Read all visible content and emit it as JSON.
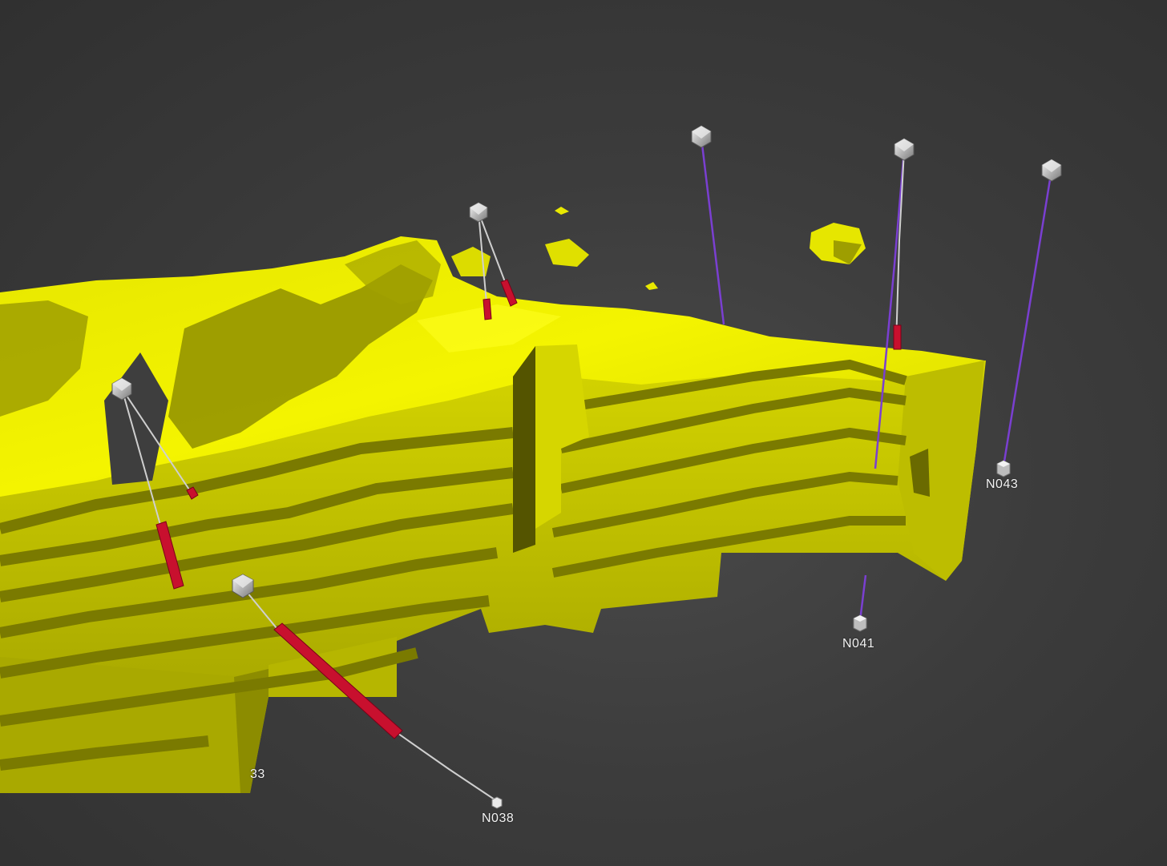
{
  "viewport": {
    "background": "#3c3c3c",
    "orebody_color": "#f0f000",
    "orebody_shadow": "#6f6f00",
    "intercept_color": "#c8102e",
    "trace_colors": {
      "planned": "#7a3fd1",
      "drilled": "#bdbdbd"
    }
  },
  "drillholes": [
    {
      "id": "N038",
      "label": "N038",
      "trace": "drilled",
      "collar_icon": "icosahedron-icon",
      "end_icon": "cube-icon"
    },
    {
      "id": "N041",
      "label": "N041",
      "trace": "planned",
      "collar_icon": "icosahedron-icon",
      "end_icon": "cube-icon"
    },
    {
      "id": "N043",
      "label": "N043",
      "trace": "planned",
      "collar_icon": "icosahedron-icon",
      "end_icon": "cube-icon"
    },
    {
      "id": "partial",
      "label": "33",
      "trace": "drilled",
      "collar_icon": "icosahedron-icon",
      "end_icon": ""
    }
  ]
}
